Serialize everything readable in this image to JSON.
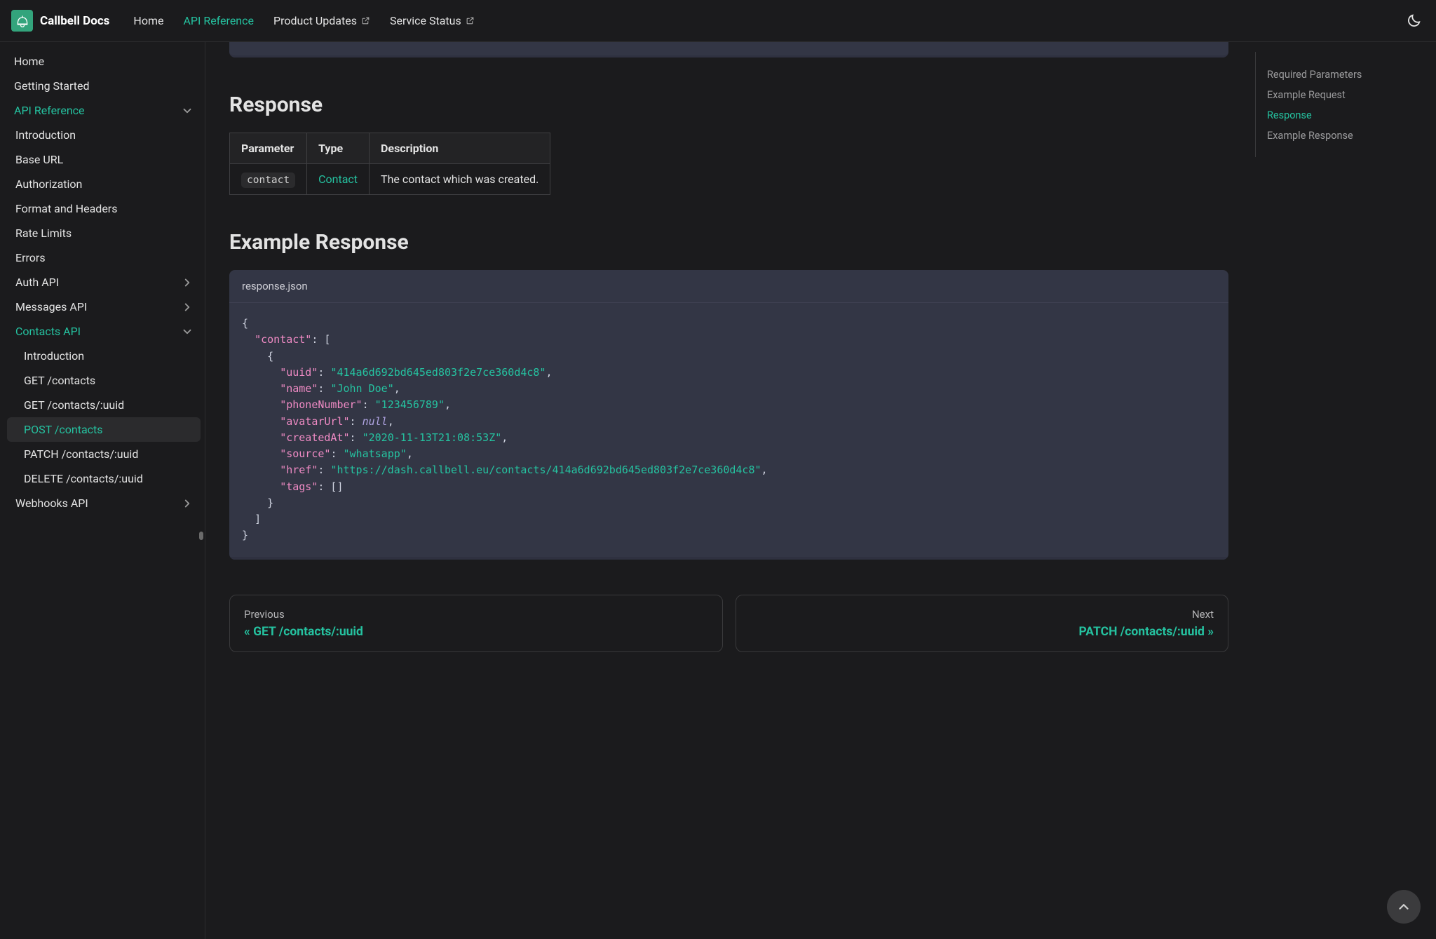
{
  "brand": "Callbell Docs",
  "nav": {
    "home": "Home",
    "apiref": "API Reference",
    "product": "Product Updates",
    "status": "Service Status"
  },
  "sidebar": {
    "home": "Home",
    "getting": "Getting Started",
    "apiref": "API Reference",
    "intro": "Introduction",
    "baseurl": "Base URL",
    "auth": "Authorization",
    "format": "Format and Headers",
    "rate": "Rate Limits",
    "errors": "Errors",
    "authapi": "Auth API",
    "msgapi": "Messages API",
    "contacts": "Contacts API",
    "c_intro": "Introduction",
    "c_get": "GET /contacts",
    "c_getuuid": "GET /contacts/:uuid",
    "c_post": "POST /contacts",
    "c_patch": "PATCH /contacts/:uuid",
    "c_delete": "DELETE /contacts/:uuid",
    "webhooks": "Webhooks API"
  },
  "toc": {
    "req": "Required Parameters",
    "exreq": "Example Request",
    "resp": "Response",
    "exresp": "Example Response"
  },
  "headings": {
    "response": "Response",
    "exresp": "Example Response"
  },
  "table": {
    "h_param": "Parameter",
    "h_type": "Type",
    "h_desc": "Description",
    "r_param": "contact",
    "r_type": "Contact",
    "r_desc": "The contact which was created."
  },
  "code": {
    "filename": "response.json",
    "uuid_k": "\"uuid\"",
    "uuid_v": "\"414a6d692bd645ed803f2e7ce360d4c8\"",
    "name_k": "\"name\"",
    "name_v": "\"John Doe\"",
    "phone_k": "\"phoneNumber\"",
    "phone_v": "\"123456789\"",
    "avatar_k": "\"avatarUrl\"",
    "avatar_v": "null",
    "created_k": "\"createdAt\"",
    "created_v": "\"2020-11-13T21:08:53Z\"",
    "source_k": "\"source\"",
    "source_v": "\"whatsapp\"",
    "href_k": "\"href\"",
    "href_v": "\"https://dash.callbell.eu/contacts/414a6d692bd645ed803f2e7ce360d4c8\"",
    "tags_k": "\"tags\"",
    "contact_k": "\"contact\""
  },
  "pager": {
    "prev_label": "Previous",
    "prev_title": "« GET /contacts/:uuid",
    "next_label": "Next",
    "next_title": "PATCH /contacts/:uuid »"
  }
}
